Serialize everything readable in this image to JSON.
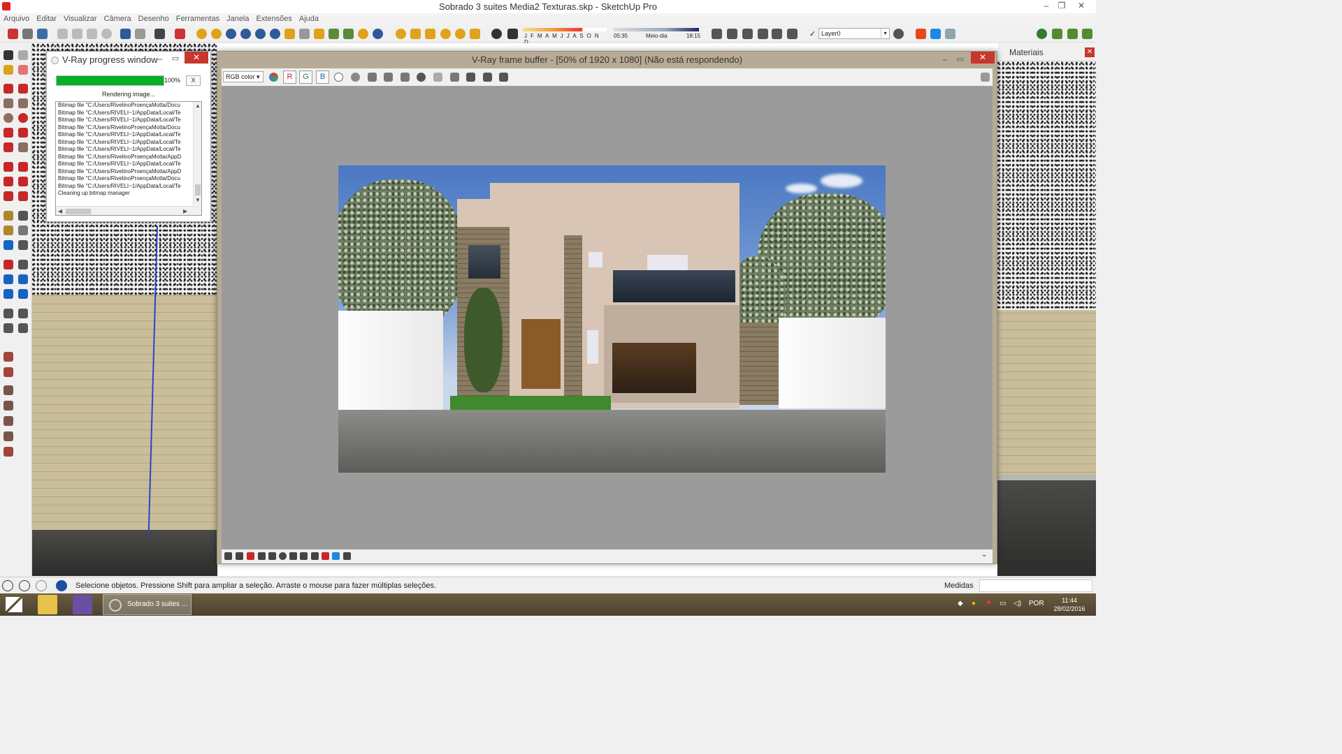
{
  "window": {
    "title": "Sobrado 3 suites Media2 Texturas.skp - SketchUp Pro",
    "controls": {
      "minimize": "–",
      "restore": "❐",
      "close": "✕"
    }
  },
  "menu": [
    "Arquivo",
    "Editar",
    "Visualizar",
    "Câmera",
    "Desenho",
    "Ferramentas",
    "Janela",
    "Extensões",
    "Ajuda"
  ],
  "toolbar": {
    "months": "J F M A M J J A S O N D",
    "time_start": "05:35",
    "time_mid": "Meio-dia",
    "time_end": "18:15",
    "layer_check": "✓",
    "layer_name": "Layer0"
  },
  "progress_window": {
    "title": "V-Ray progress window",
    "progress": 1.0,
    "progress_label": "100%",
    "cancel_label": "X",
    "status": "Rendering image...",
    "log": [
      "Bitmap file \"C:/Users/RivelinoProençaMotta/Docu",
      "Bitmap file \"C:/Users/RIVELI~1/AppData/Local/Te",
      "Bitmap file \"C:/Users/RIVELI~1/AppData/Local/Te",
      "Bitmap file \"C:/Users/RivelinoProençaMotta/Docu",
      "Bitmap file \"C:/Users/RIVELI~1/AppData/Local/Te",
      "Bitmap file \"C:/Users/RIVELI~1/AppData/Local/Te",
      "Bitmap file \"C:/Users/RIVELI~1/AppData/Local/Te",
      "Bitmap file \"C:/Users/RivelinoProençaMotta/AppD",
      "Bitmap file \"C:/Users/RIVELI~1/AppData/Local/Te",
      "Bitmap file \"C:/Users/RivelinoProençaMotta/AppD",
      "Bitmap file \"C:/Users/RivelinoProençaMotta/Docu",
      "Bitmap file \"C:/Users/RIVELI~1/AppData/Local/Te",
      "Cleaning up bitmap manager"
    ]
  },
  "frame_buffer": {
    "title": "V-Ray frame buffer - [50% of 1920 x 1080] (Não está respondendo)",
    "channel_select": "RGB color",
    "channels": [
      "R",
      "G",
      "B"
    ]
  },
  "materials_panel": {
    "title": "Materiais",
    "close": "✕"
  },
  "status": {
    "message": "Selecione objetos. Pressione Shift para ampliar a seleção. Arraste o mouse para fazer múltiplas seleções.",
    "measure_label": "Medidas",
    "measure_value": ""
  },
  "taskbar": {
    "active_task": "Sobrado 3 suites ...",
    "language": "POR",
    "time": "11:44",
    "date": "28/02/2016"
  },
  "colors": {
    "accent_close": "#c8372b",
    "progress": "#06b025",
    "axis_blue": "#2a45c6"
  }
}
